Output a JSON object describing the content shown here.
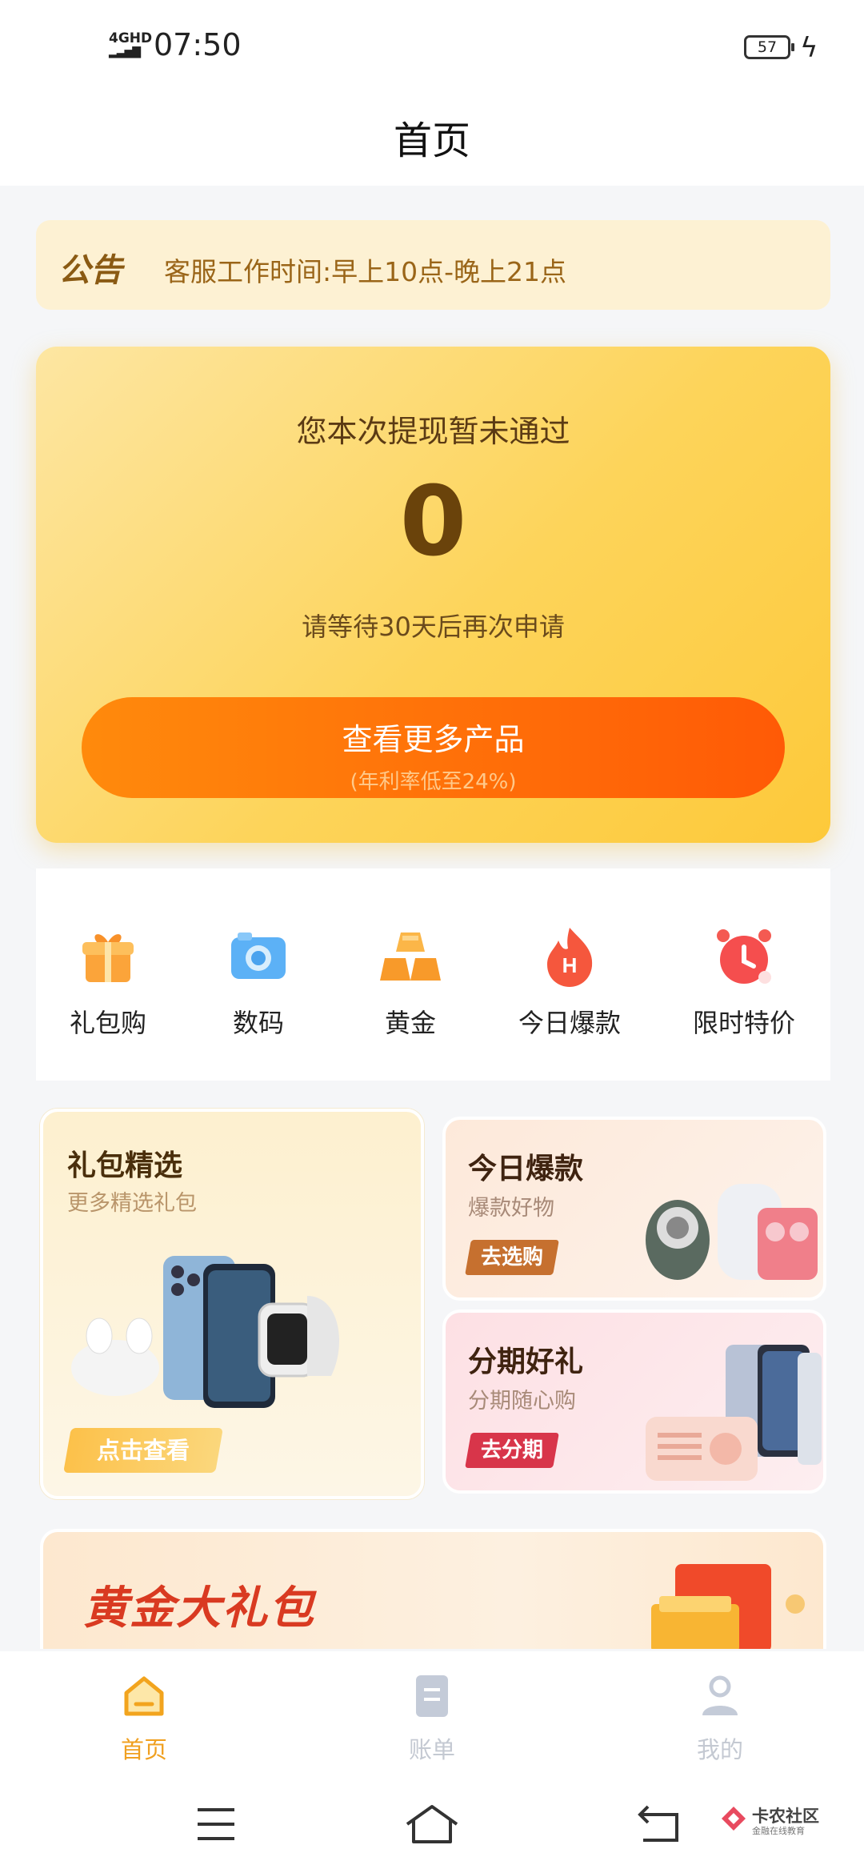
{
  "status_bar": {
    "network": "4GHD",
    "time": "07:50",
    "battery": "57"
  },
  "header": {
    "title": "首页"
  },
  "notice": {
    "tag": "公告",
    "text": "客服工作时间:早上10点-晚上21点"
  },
  "main_card": {
    "title": "您本次提现暂未通过",
    "value": "0",
    "subtitle": "请等待30天后再次申请",
    "button_label": "查看更多产品",
    "button_sub": "(年利率低至24%)"
  },
  "categories": [
    {
      "label": "礼包购",
      "icon": "gift-icon"
    },
    {
      "label": "数码",
      "icon": "camera-icon"
    },
    {
      "label": "黄金",
      "icon": "gold-bar-icon"
    },
    {
      "label": "今日爆款",
      "icon": "fire-icon"
    },
    {
      "label": "限时特价",
      "icon": "alarm-clock-icon"
    }
  ],
  "promos": {
    "featured": {
      "title": "礼包精选",
      "subtitle": "更多精选礼包",
      "button": "点击查看"
    },
    "hot": {
      "title": "今日爆款",
      "subtitle": "爆款好物",
      "button": "去选购"
    },
    "installment": {
      "title": "分期好礼",
      "subtitle": "分期随心购",
      "button": "去分期"
    },
    "gold_banner": {
      "title": "黄金大礼包"
    }
  },
  "tabbar": [
    {
      "label": "首页",
      "icon": "home-icon",
      "active": true
    },
    {
      "label": "账单",
      "icon": "bill-icon",
      "active": false
    },
    {
      "label": "我的",
      "icon": "profile-icon",
      "active": false
    }
  ],
  "watermark": {
    "text": "卡农社区",
    "subtext": "金融在线教育"
  },
  "colors": {
    "accent": "#f5a623",
    "button_orange": "#ff6a08",
    "tab_active": "#f0a020",
    "tab_inactive": "#c4c9d2"
  }
}
